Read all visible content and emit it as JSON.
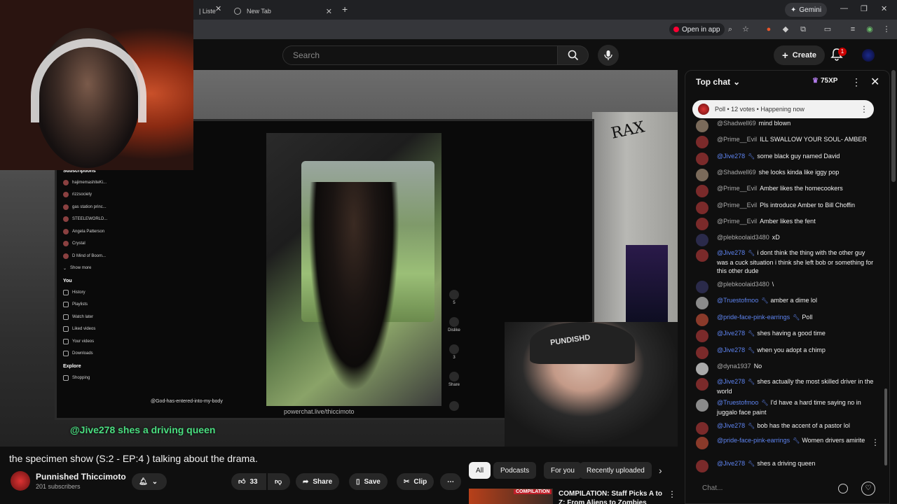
{
  "browser": {
    "tab1_label": "| Liste",
    "tab2_label": "New Tab",
    "new_tab": "+",
    "gemini_label": "Gemini",
    "open_in_app": "Open in app"
  },
  "masthead": {
    "search_placeholder": "Search",
    "create_label": "Create",
    "notif_count": "1"
  },
  "video": {
    "sidebar_header": "Subscriptions",
    "subscriptions": [
      "hajimemashiteKi...",
      "rizzsociety",
      "gas station princ...",
      "STEELEWORLD...",
      "Angela Patterson",
      "Crystal",
      "D Mind of Boom..."
    ],
    "show_more": "Show more",
    "you_header": "You",
    "you_items": [
      "History",
      "Playlists",
      "Watch later",
      "Liked videos",
      "Your videos",
      "Downloads"
    ],
    "explore_header": "Explore",
    "explore_items": [
      "Shopping"
    ],
    "actions": [
      {
        "icon": "thumbs-up-icon",
        "label": "5"
      },
      {
        "icon": "thumbs-down-icon",
        "label": "Dislike"
      },
      {
        "icon": "comment-icon",
        "label": "3"
      },
      {
        "icon": "share-icon",
        "label": "Share"
      },
      {
        "icon": "remix-icon",
        "label": ""
      }
    ],
    "entered_text": "@God-has-entered-into-my-body",
    "watermark": "powerchat.live/thiccimoto",
    "overlay_chat": "@Jive278  shes a driving queen",
    "cap_text": "PUNDISHD"
  },
  "info": {
    "title": "the specimen show (S:2 - EP:4 ) talking about the drama.",
    "channel_name": "Punnished Thiccimoto",
    "subscribers": "201 subscribers",
    "likes": "33",
    "share": "Share",
    "save": "Save",
    "clip": "Clip"
  },
  "recommendations": {
    "chips": [
      "All",
      "Podcasts",
      "For you",
      "Recently uploaded"
    ],
    "active_chip": "All",
    "rec_badge": "COMPILATION",
    "rec_title": "COMPILATION: Staff Picks A to Z: From Aliens to Zombies"
  },
  "chat": {
    "header": "Top chat",
    "xp": "75XP",
    "poll": "Poll • 12 votes • Happening now",
    "input_placeholder": "Chat...",
    "messages": [
      {
        "author": "@Shadwell69",
        "text": "mind blown",
        "mod": false,
        "avatar": "#7a6a5a"
      },
      {
        "author": "@Prime__Evil",
        "text": "ILL SWALLOW YOUR SOUL- AMBER",
        "mod": false,
        "avatar": "#7a2a2a"
      },
      {
        "author": "@Jive278",
        "text": "some black guy named David",
        "mod": true,
        "avatar": "#7a2a2a"
      },
      {
        "author": "@Shadwell69",
        "text": "she looks kinda like iggy pop",
        "mod": false,
        "avatar": "#7a6a5a"
      },
      {
        "author": "@Prime__Evil",
        "text": "Amber likes the homecookers",
        "mod": false,
        "avatar": "#7a2a2a"
      },
      {
        "author": "@Prime__Evil",
        "text": "Pls introduce Amber to Bill Choffin",
        "mod": false,
        "avatar": "#7a2a2a"
      },
      {
        "author": "@Prime__Evil",
        "text": "Amber likes the fent",
        "mod": false,
        "avatar": "#7a2a2a"
      },
      {
        "author": "@plebkoolaid3480",
        "text": "xD",
        "mod": false,
        "avatar": "#2a2a4a"
      },
      {
        "author": "@Jive278",
        "text": "i dont think the thing with the other guy was a cuck situation i think she left bob or something for this other dude",
        "mod": true,
        "avatar": "#7a2a2a"
      },
      {
        "author": "@plebkoolaid3480",
        "text": "\\",
        "mod": false,
        "avatar": "#2a2a4a"
      },
      {
        "author": "@Truestofmoo",
        "text": "amber a dime lol",
        "mod": true,
        "avatar": "#8a8a8a"
      },
      {
        "author": "@pride-face-pink-earrings",
        "text": "Poll",
        "mod": true,
        "avatar": "#8a3a2a"
      },
      {
        "author": "@Jive278",
        "text": "shes having a good time",
        "mod": true,
        "avatar": "#7a2a2a"
      },
      {
        "author": "@Jive278",
        "text": "when you adopt a chimp",
        "mod": true,
        "avatar": "#7a2a2a"
      },
      {
        "author": "@dyna1937",
        "text": "No",
        "mod": false,
        "avatar": "#aaaaaa"
      },
      {
        "author": "@Jive278",
        "text": "shes actually the most skilled driver in the world",
        "mod": true,
        "avatar": "#7a2a2a"
      },
      {
        "author": "@Truestofmoo",
        "text": "I'd have a hard time saying no in juggalo face paint",
        "mod": true,
        "avatar": "#8a8a8a"
      },
      {
        "author": "@Jive278",
        "text": "bob has the accent of a pastor lol",
        "mod": true,
        "avatar": "#7a2a2a"
      },
      {
        "author": "@pride-face-pink-earrings",
        "text": "Women drivers amirite",
        "mod": true,
        "avatar": "#8a3a2a"
      },
      {
        "author": "@Jive278",
        "text": "shes a driving queen",
        "mod": true,
        "avatar": "#7a2a2a"
      }
    ]
  }
}
